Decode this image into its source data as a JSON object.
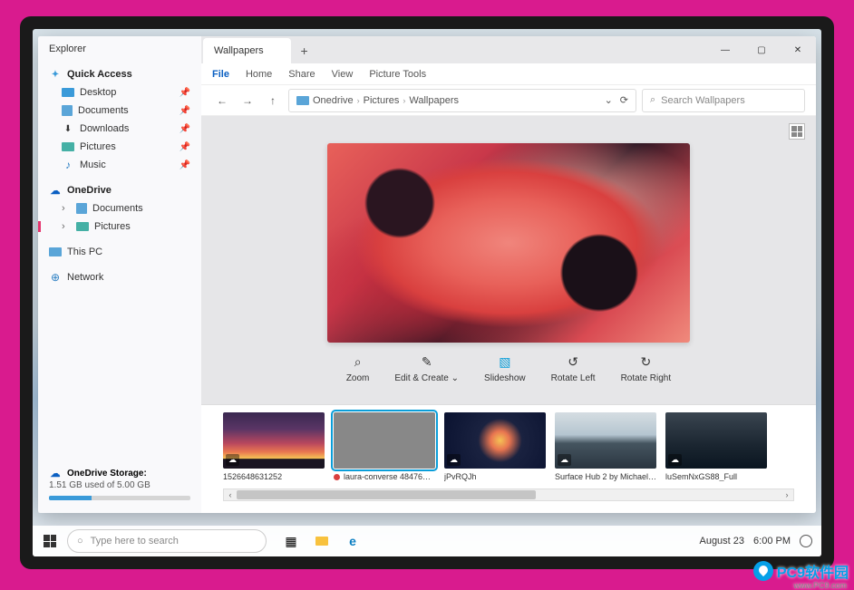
{
  "sidebar": {
    "title": "Explorer",
    "quick_access": {
      "label": "Quick Access",
      "items": [
        {
          "label": "Desktop"
        },
        {
          "label": "Documents"
        },
        {
          "label": "Downloads"
        },
        {
          "label": "Pictures"
        },
        {
          "label": "Music"
        }
      ]
    },
    "onedrive": {
      "label": "OneDrive",
      "items": [
        {
          "label": "Documents"
        },
        {
          "label": "Pictures"
        }
      ]
    },
    "this_pc": {
      "label": "This PC"
    },
    "network": {
      "label": "Network"
    },
    "storage": {
      "title": "OneDrive Storage:",
      "text": "1.51 GB used of 5.00 GB"
    }
  },
  "tabs": {
    "active": "Wallpapers",
    "add": "+"
  },
  "window_controls": {
    "min": "—",
    "max": "▢",
    "close": "✕"
  },
  "ribbon": {
    "items": [
      "File",
      "Home",
      "Share",
      "View",
      "Picture Tools"
    ],
    "active": "File"
  },
  "nav": {
    "back": "←",
    "forward": "→",
    "up": "↑"
  },
  "breadcrumb": {
    "parts": [
      "Onedrive",
      "Pictures",
      "Wallpapers"
    ],
    "dropdown": "⌄",
    "refresh": "⟳"
  },
  "search": {
    "placeholder": "Search Wallpapers",
    "icon": "⌕"
  },
  "tools": [
    {
      "icon": "⌕",
      "label": "Zoom"
    },
    {
      "icon": "✎",
      "label": "Edit & Create",
      "drop": "⌄"
    },
    {
      "icon": "▧",
      "label": "Slideshow",
      "accent": true
    },
    {
      "icon": "↺",
      "label": "Rotate Left"
    },
    {
      "icon": "↻",
      "label": "Rotate Right"
    }
  ],
  "thumbs": [
    {
      "label": "1526648631252"
    },
    {
      "label": "laura-converse 48476…",
      "selected": true,
      "sync": true
    },
    {
      "label": "jPvRQJh"
    },
    {
      "label": "Surface Hub 2 by Michael…"
    },
    {
      "label": "luSemNxGS88_Full"
    }
  ],
  "taskbar": {
    "search": "Type here to search",
    "date": "August 23",
    "time": "6:00 PM"
  },
  "watermark": {
    "text": "PC9软件园",
    "sub": "www.PC9.com"
  }
}
